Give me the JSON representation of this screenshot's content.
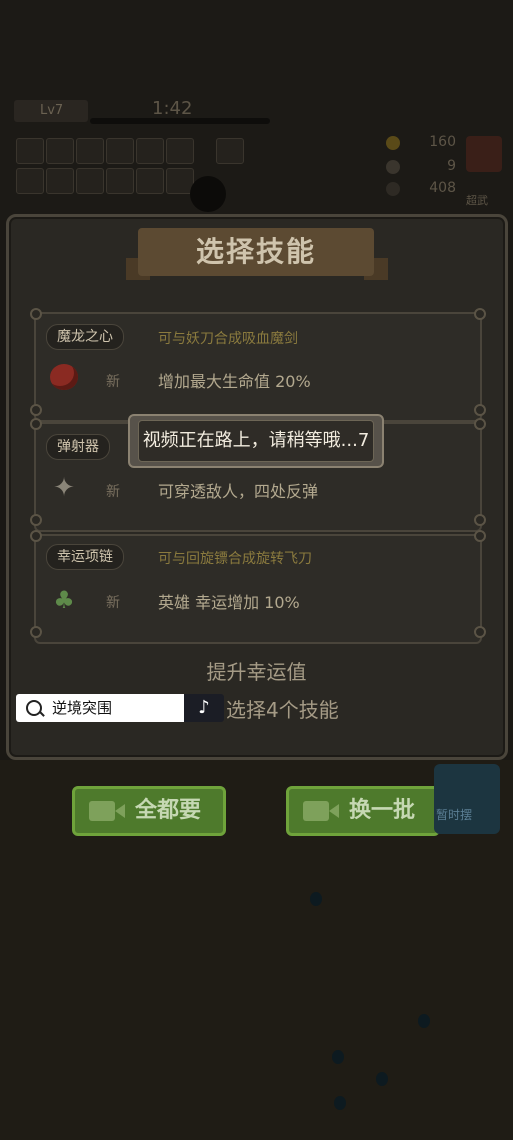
{
  "hud": {
    "level": "Lv7",
    "timer": "1:42",
    "stats": [
      "160",
      "9",
      "408"
    ],
    "side_button": "超武"
  },
  "dialog": {
    "title": "选择技能",
    "cards": [
      {
        "name": "魔龙之心",
        "hint": "可与妖刀合成吸血魔剑",
        "badge": "新",
        "desc": "增加最大生命值 20%",
        "icon": "red-gem-icon"
      },
      {
        "name": "弹射器",
        "hint": "",
        "badge": "新",
        "desc": "可穿透敌人，四处反弹",
        "icon": "shuriken-icon"
      },
      {
        "name": "幸运项链",
        "hint": "可与回旋镖合成旋转飞刀",
        "badge": "新",
        "desc": "英雄 幸运增加 10%",
        "icon": "clover-necklace-icon"
      }
    ],
    "luck_label": "提升幸运值",
    "pick_label": "选择4个技能"
  },
  "toast": {
    "text": "视频正在路上，请稍等哦...7"
  },
  "buttons": {
    "take_all": "全都要",
    "refresh": "换一批"
  },
  "side_tv": {
    "label": "暂时摆"
  },
  "search": {
    "text": "逆境突围",
    "icon": "search-icon",
    "brand_icon": "tiktok-icon"
  },
  "colors": {
    "button_green": "#4e7a2c",
    "panel_bg": "#2a2823",
    "banner": "#5c4a32"
  }
}
